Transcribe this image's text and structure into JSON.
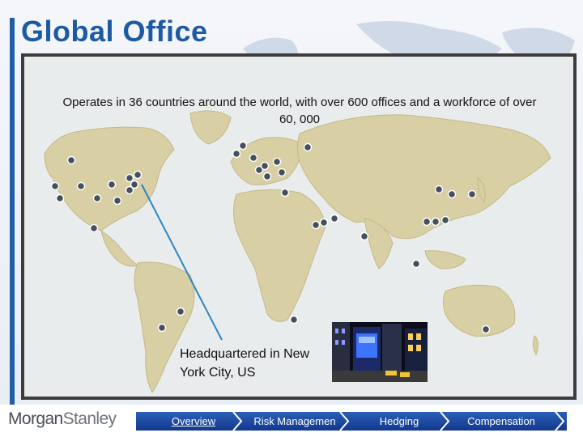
{
  "slide": {
    "title": "Global Office",
    "intro": "Operates in 36 countries around the world, with over 600 offices and a workforce of over 60, 000",
    "hq_caption": "Headquartered in New York City, US"
  },
  "footer": {
    "logo_left": "Morgan",
    "logo_right": "Stanley",
    "nav": [
      {
        "label": "Overview",
        "active": true
      },
      {
        "label": "Risk Managemen",
        "active": false
      },
      {
        "label": "Hedging",
        "active": false
      },
      {
        "label": "Compensation",
        "active": false
      }
    ]
  },
  "colors": {
    "title": "#1d5aa3",
    "accent_bar": "#1f5fa8",
    "nav_bar": "#1a46a0",
    "land": "#d8cfa4",
    "ocean": "#e9ecec",
    "office_dot": "#44505e"
  }
}
